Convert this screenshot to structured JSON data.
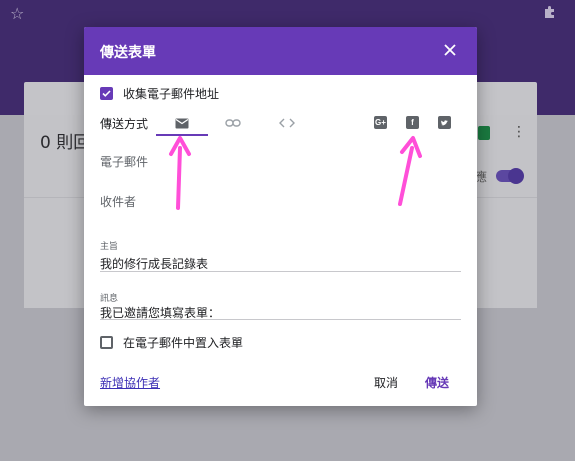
{
  "background": {
    "response_count": "0 則回",
    "right_text": "應"
  },
  "dialog": {
    "title": "傳送表單",
    "collect_email_label": "收集電子郵件地址",
    "collect_email_checked": true,
    "send_via_label": "傳送方式",
    "email_label": "電子郵件",
    "recipients_label": "收件者",
    "subject_label": "主旨",
    "subject_value": "我的修行成長記錄表",
    "message_label": "訊息",
    "message_value": "我已邀請您填寫表單：",
    "embed_label": "在電子郵件中置入表單",
    "embed_checked": false,
    "add_collaborators": "新增協作者",
    "cancel_label": "取消",
    "send_label": "傳送"
  },
  "colors": {
    "accent": "#673ab7",
    "annotation_arrow": "#ff4fd8"
  },
  "icons": [
    "star-icon",
    "puzzle-icon",
    "close-icon",
    "email-icon",
    "link-icon",
    "embed-code-icon",
    "google-plus-icon",
    "facebook-icon",
    "twitter-icon"
  ]
}
